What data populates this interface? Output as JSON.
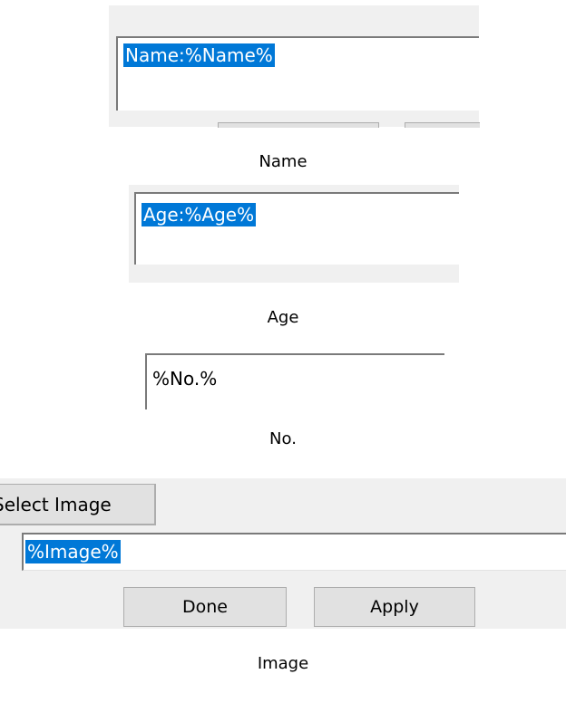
{
  "name_section": {
    "field_value": "Name:%Name%",
    "caption": "Name"
  },
  "age_section": {
    "field_value": "Age:%Age%",
    "caption": "Age"
  },
  "no_section": {
    "field_value": "%No.%",
    "caption": "No."
  },
  "image_section": {
    "select_button_label": "Select Image",
    "field_value": "%Image%",
    "done_label": "Done",
    "apply_label": "Apply",
    "caption": "Image"
  },
  "colors": {
    "selection": "#0078d7",
    "panel": "#f0f0f0",
    "button": "#e1e1e1"
  }
}
